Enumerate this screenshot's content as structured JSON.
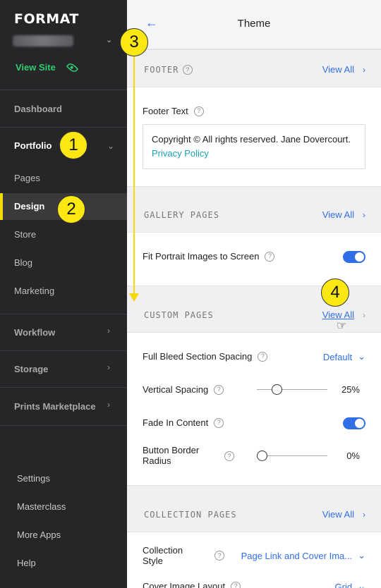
{
  "sidebar": {
    "logo": "FORMAT",
    "view_site": "View Site",
    "items": {
      "dashboard": "Dashboard",
      "portfolio": "Portfolio",
      "pages": "Pages",
      "design": "Design",
      "store": "Store",
      "blog": "Blog",
      "marketing": "Marketing",
      "workflow": "Workflow",
      "storage": "Storage",
      "prints": "Prints Marketplace"
    },
    "bottom": {
      "settings": "Settings",
      "masterclass": "Masterclass",
      "more_apps": "More Apps",
      "help": "Help"
    }
  },
  "badges": {
    "b1": "1",
    "b2": "2",
    "b3": "3",
    "b4": "4"
  },
  "header": {
    "title": "Theme"
  },
  "sections": {
    "footer": {
      "title": "FOOTER",
      "view_all": "View All",
      "footer_text_label": "Footer Text",
      "footer_text_value": "Copyright © All rights reserved. Jane Dovercourt.",
      "footer_link": "Privacy Policy"
    },
    "gallery": {
      "title": "GALLERY PAGES",
      "view_all": "View All",
      "fit_portrait": "Fit Portrait Images to Screen",
      "fit_portrait_on": true
    },
    "custom": {
      "title": "CUSTOM PAGES",
      "view_all": "View All",
      "full_bleed": "Full Bleed Section Spacing",
      "full_bleed_value": "Default",
      "vertical_spacing": "Vertical Spacing",
      "vertical_spacing_value": "25%",
      "fade_in": "Fade In Content",
      "fade_in_on": true,
      "button_radius_line1": "Button Border",
      "button_radius_line2": "Radius",
      "button_radius_value": "0%"
    },
    "collection": {
      "title": "COLLECTION PAGES",
      "view_all": "View All",
      "style_line1": "Collection",
      "style_line2": "Style",
      "style_value": "Page Link and Cover Ima...",
      "cover_layout": "Cover Image Layout",
      "cover_layout_value": "Grid"
    }
  },
  "colors": {
    "accent": "#2f6ee5",
    "badge": "#fbe712",
    "green": "#2ecc71",
    "sidebar_bg": "#262628"
  }
}
